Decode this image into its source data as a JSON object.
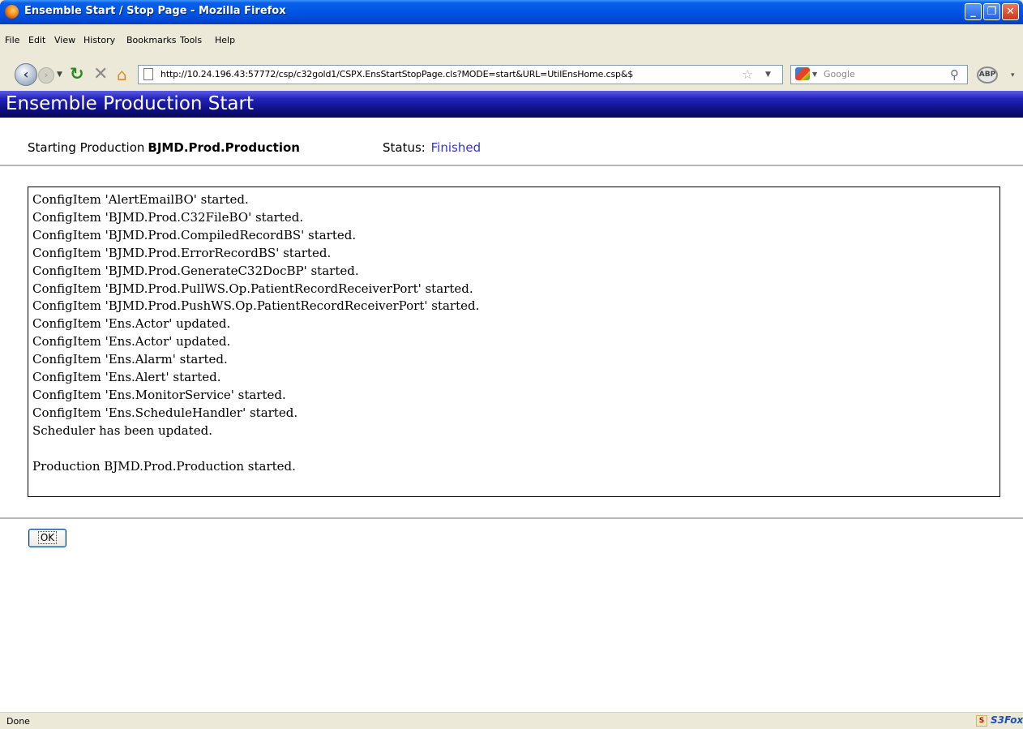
{
  "window": {
    "title": "Ensemble Start / Stop Page - Mozilla Firefox"
  },
  "menu": {
    "items": [
      "File",
      "Edit",
      "View",
      "History",
      "Bookmarks",
      "Tools",
      "Help"
    ]
  },
  "toolbar": {
    "url": "http://10.24.196.43:57772/csp/c32gold1/CSPX.EnsStartStopPage.cls?MODE=start&URL=UtilEnsHome.csp&$",
    "search_placeholder": "Google",
    "abp_label": "ABP"
  },
  "page": {
    "header_title": "Ensemble Production Start",
    "starting_label": "Starting Production",
    "production_name": "BJMD.Prod.Production",
    "status_label": "Status:",
    "status_value": "Finished",
    "log_lines": [
      "ConfigItem 'AlertEmailBO' started.",
      "ConfigItem 'BJMD.Prod.C32FileBO' started.",
      "ConfigItem 'BJMD.Prod.CompiledRecordBS' started.",
      "ConfigItem 'BJMD.Prod.ErrorRecordBS' started.",
      "ConfigItem 'BJMD.Prod.GenerateC32DocBP' started.",
      "ConfigItem 'BJMD.Prod.PullWS.Op.PatientRecordReceiverPort' started.",
      "ConfigItem 'BJMD.Prod.PushWS.Op.PatientRecordReceiverPort' started.",
      "ConfigItem 'Ens.Actor' updated.",
      "ConfigItem 'Ens.Actor' updated.",
      "ConfigItem 'Ens.Alarm' started.",
      "ConfigItem 'Ens.Alert' started.",
      "ConfigItem 'Ens.MonitorService' started.",
      "ConfigItem 'Ens.ScheduleHandler' started.",
      "Scheduler has been updated.",
      "",
      "Production BJMD.Prod.Production started."
    ],
    "ok_label": "OK"
  },
  "statusbar": {
    "text": "Done",
    "addon_label": "S3Fox"
  },
  "colors": {
    "header_dark": "#0d0d80",
    "status_value": "#3333cc",
    "chrome": "#ece9d8"
  }
}
